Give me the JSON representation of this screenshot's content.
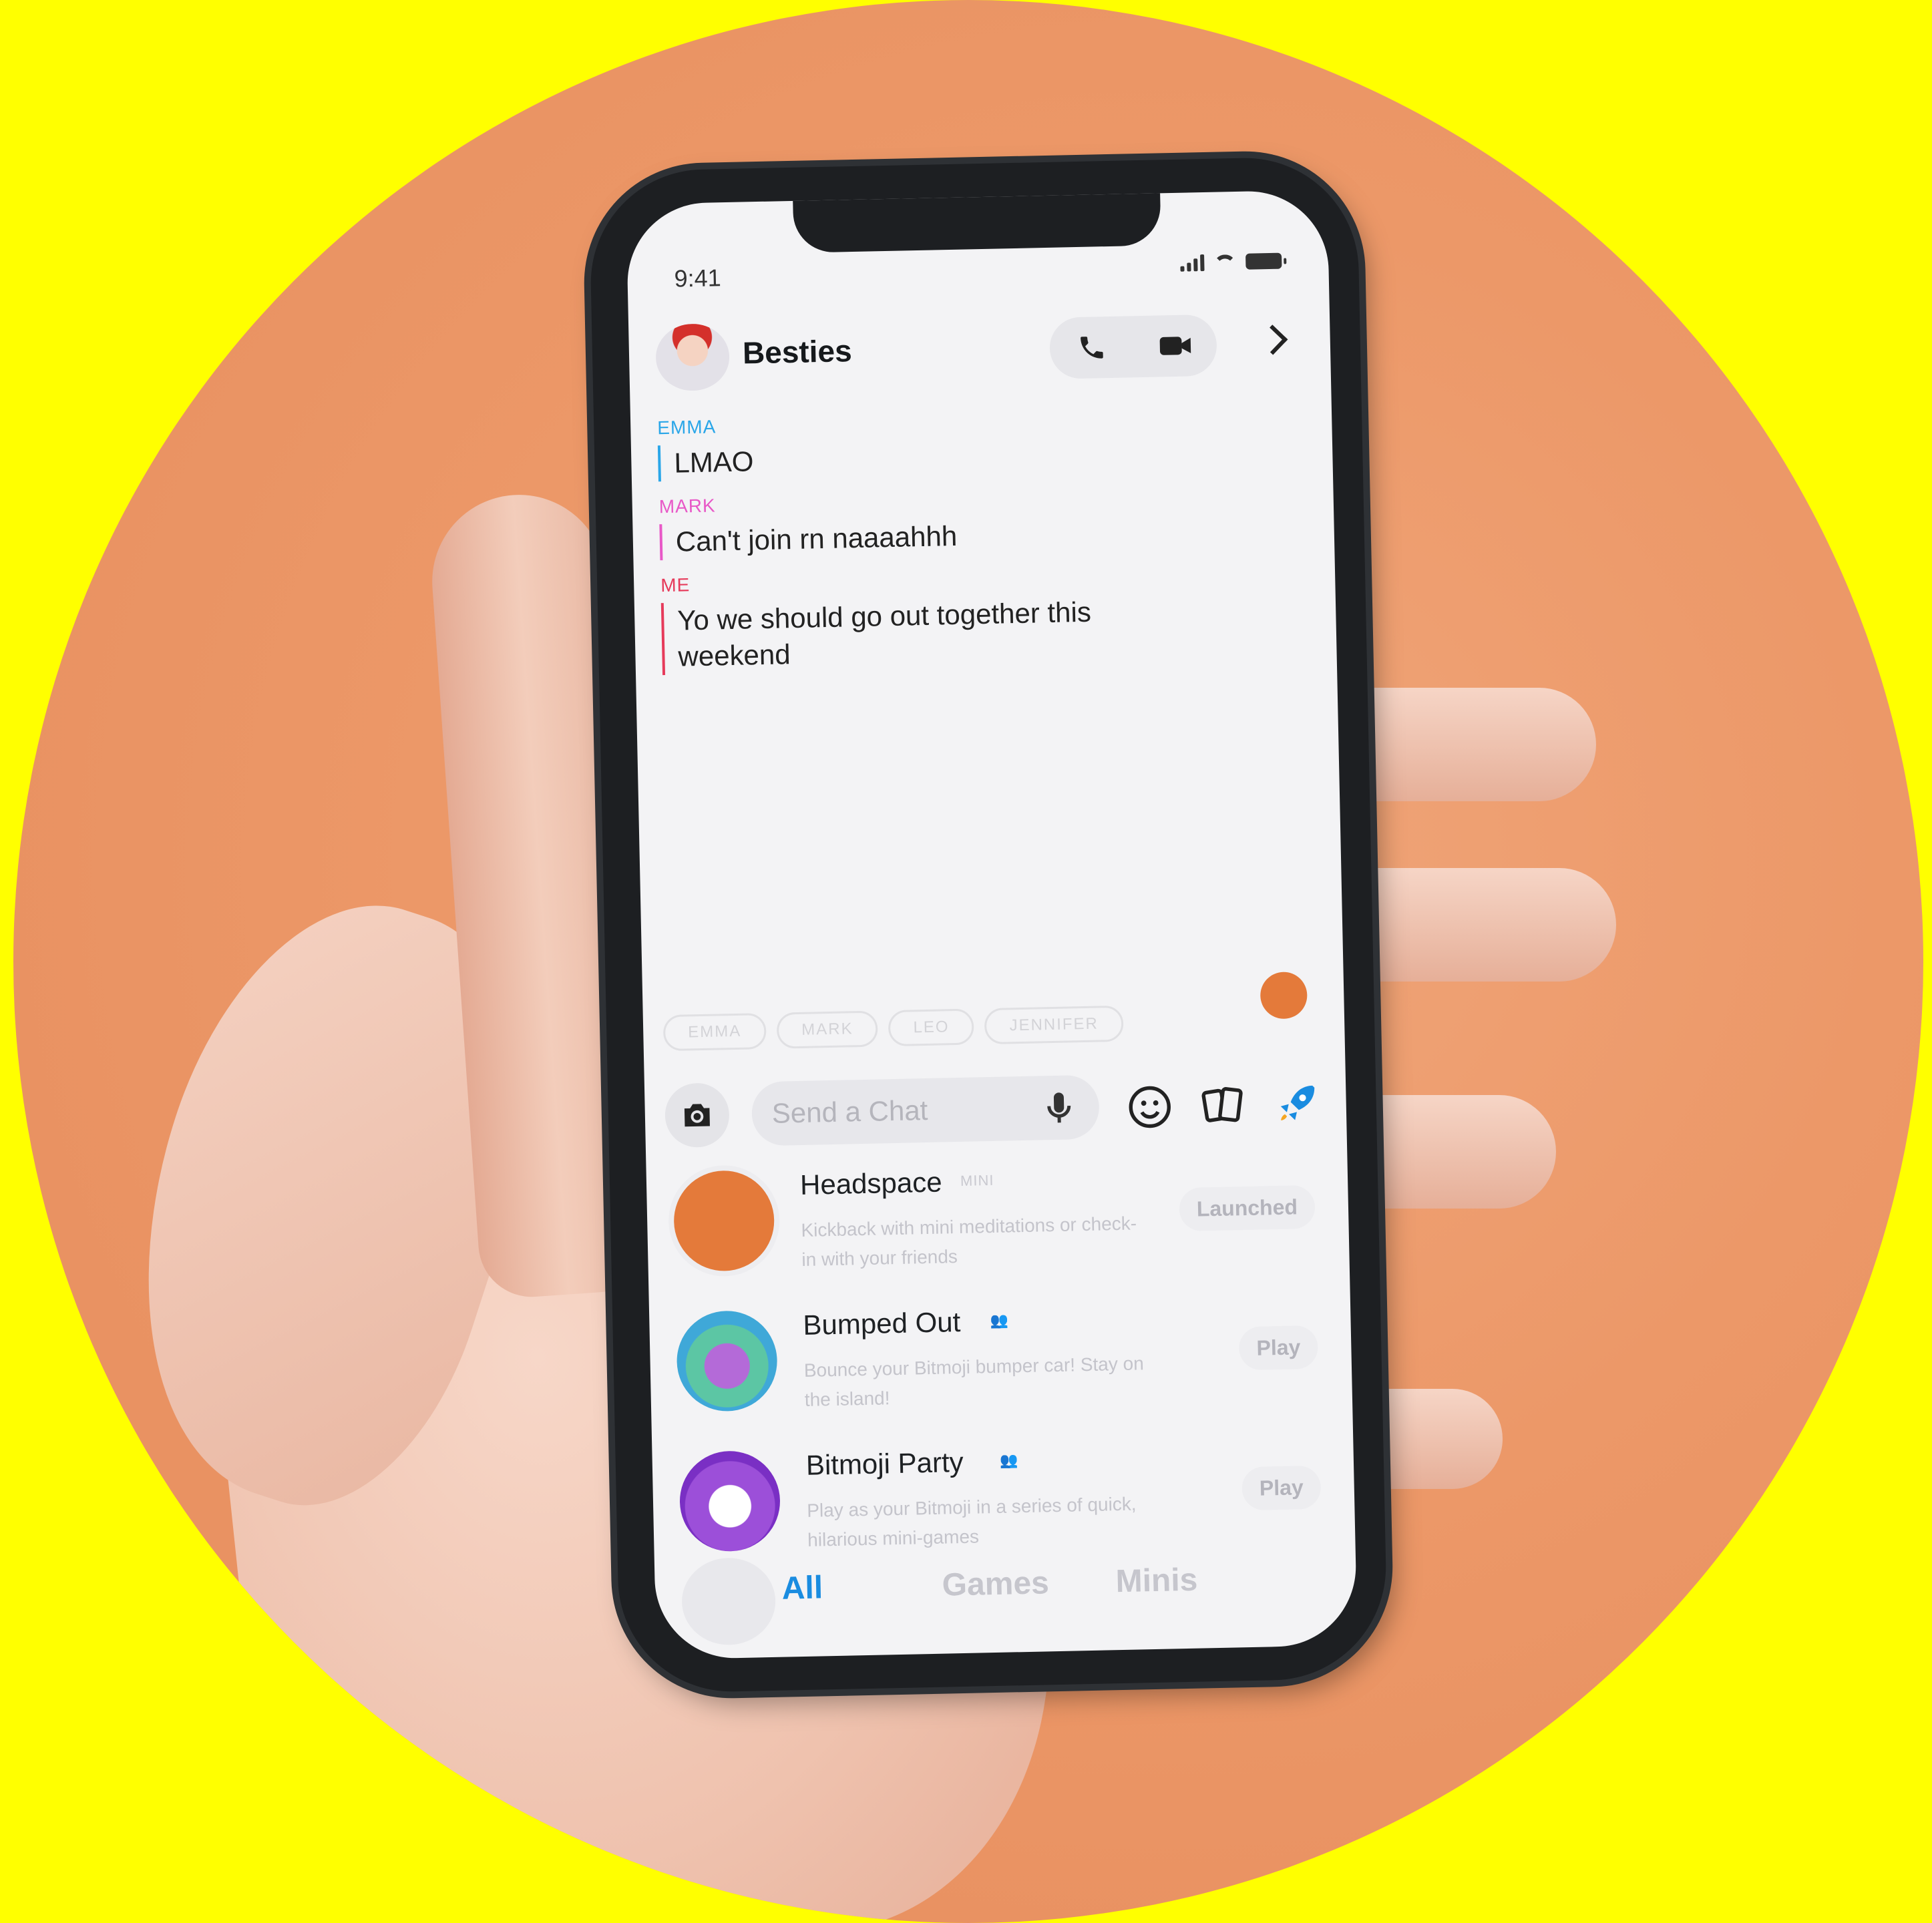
{
  "status_bar": {
    "time": "9:41"
  },
  "chat": {
    "title": "Besties",
    "messages": [
      {
        "sender": "EMMA",
        "text": "LMAO",
        "color": "#2AA6E8"
      },
      {
        "sender": "MARK",
        "text": "Can't join rn naaaahhh",
        "color": "#E858C7"
      },
      {
        "sender": "ME",
        "text": "Yo we should go out together this weekend",
        "color": "#E63A5A"
      }
    ]
  },
  "mentions": [
    "EMMA",
    "MARK",
    "LEO",
    "JENNIFER"
  ],
  "input": {
    "placeholder": "Send a Chat"
  },
  "icons": {
    "phone": "phone-icon",
    "video": "video-icon",
    "camera": "camera-icon",
    "mic": "microphone-icon",
    "emoji": "smiley-icon",
    "cards": "cards-icon",
    "rocket": "rocket-icon"
  },
  "minis": [
    {
      "name": "Headspace",
      "tag": "MINI",
      "description": "Kickback with mini meditations or check-in with your friends",
      "action": "Launched"
    },
    {
      "name": "Bumped Out",
      "tag": "",
      "description": "Bounce your Bitmoji bumper car! Stay on the island!",
      "action": "Play"
    },
    {
      "name": "Bitmoji Party",
      "tag": "",
      "description": "Play as your Bitmoji in a series of quick, hilarious mini-games",
      "action": "Play"
    }
  ],
  "tabs": [
    {
      "label": "All",
      "active": true
    },
    {
      "label": "Games",
      "active": false
    },
    {
      "label": "Minis",
      "active": false
    }
  ],
  "colors": {
    "background": "#FFFF00",
    "disc": "#EC9868",
    "accent": "#1A8CE0",
    "headspace_orange": "#E47A3A"
  }
}
